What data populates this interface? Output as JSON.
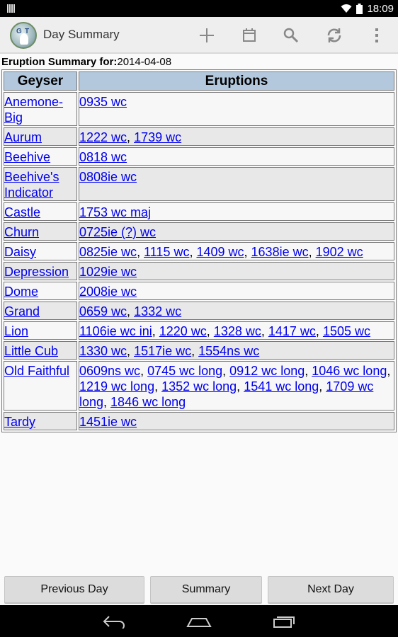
{
  "status_bar": {
    "time": "18:09"
  },
  "action_bar": {
    "title": "Day Summary",
    "logo_letters": [
      "G",
      "T"
    ]
  },
  "summary": {
    "label": "Eruption Summary for:",
    "date": "2014-04-08"
  },
  "table": {
    "headers": [
      "Geyser",
      "Eruptions"
    ],
    "rows": [
      {
        "geyser": "Anemone-Big",
        "eruptions": [
          "0935 wc"
        ]
      },
      {
        "geyser": "Aurum",
        "eruptions": [
          "1222 wc",
          "1739 wc"
        ]
      },
      {
        "geyser": "Beehive",
        "eruptions": [
          "0818 wc"
        ]
      },
      {
        "geyser": "Beehive's Indicator",
        "eruptions": [
          "0808ie wc"
        ]
      },
      {
        "geyser": "Castle",
        "eruptions": [
          "1753 wc maj"
        ]
      },
      {
        "geyser": "Churn",
        "eruptions": [
          "0725ie (?) wc"
        ]
      },
      {
        "geyser": "Daisy",
        "eruptions": [
          "0825ie wc",
          "1115 wc",
          "1409 wc",
          "1638ie wc",
          "1902 wc"
        ]
      },
      {
        "geyser": "Depression",
        "eruptions": [
          "1029ie wc"
        ]
      },
      {
        "geyser": "Dome",
        "eruptions": [
          "2008ie wc"
        ]
      },
      {
        "geyser": "Grand",
        "eruptions": [
          "0659 wc",
          "1332 wc"
        ]
      },
      {
        "geyser": "Lion",
        "eruptions": [
          "1106ie wc ini",
          "1220 wc",
          "1328 wc",
          "1417 wc",
          "1505 wc"
        ]
      },
      {
        "geyser": "Little Cub",
        "eruptions": [
          "1330 wc",
          "1517ie wc",
          "1554ns wc"
        ]
      },
      {
        "geyser": "Old Faithful",
        "eruptions": [
          "0609ns wc",
          "0745 wc long",
          "0912 wc long",
          "1046 wc long",
          "1219 wc long",
          "1352 wc long",
          "1541 wc long",
          "1709 wc long",
          "1846 wc long"
        ]
      },
      {
        "geyser": "Tardy",
        "eruptions": [
          "1451ie wc"
        ]
      }
    ]
  },
  "buttons": {
    "previous_day": "Previous Day",
    "summary": "Summary",
    "next_day": "Next Day"
  },
  "colors": {
    "header_bg": "#b3c8dd",
    "link": "#0000ee",
    "action_bar_bg": "#eeeeee"
  }
}
